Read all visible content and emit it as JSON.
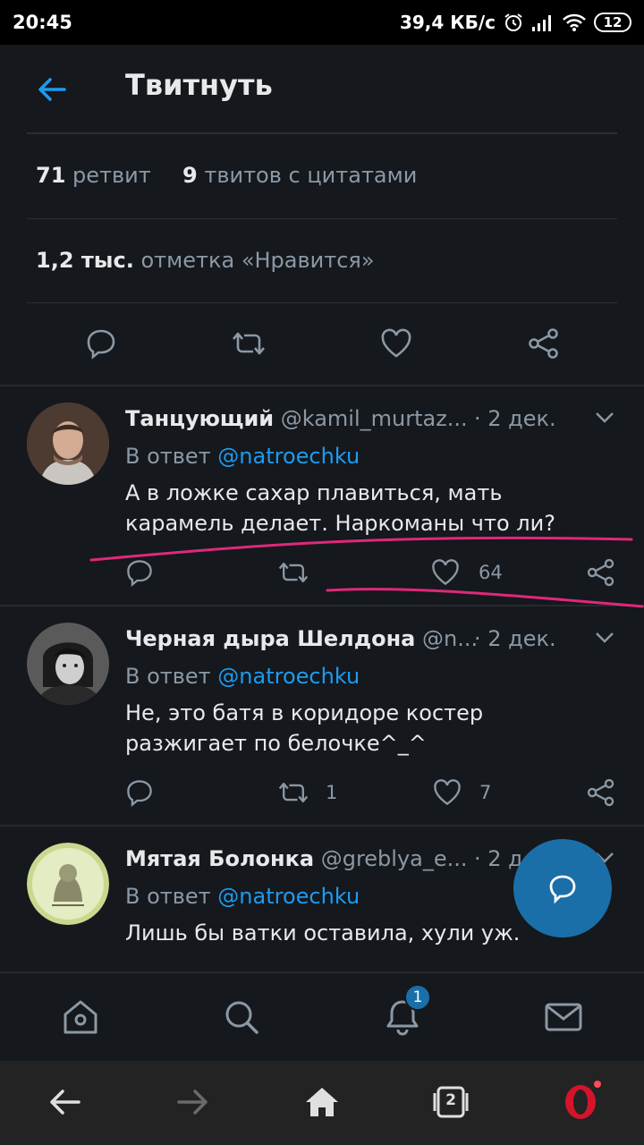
{
  "status_bar": {
    "time": "20:45",
    "network_speed": "39,4 КБ/с",
    "battery": "12"
  },
  "header": {
    "title": "Твитнуть",
    "back_icon": "arrow-left-icon"
  },
  "stats": {
    "retweets_count": "71",
    "retweets_label": "ретвит",
    "quotes_count": "9",
    "quotes_label": "твитов с цитатами",
    "likes_count": "1,2 тыс.",
    "likes_label": "отметка «Нравится»"
  },
  "replies": [
    {
      "name": "Танцующий",
      "handle": "@kamil_murtaz...",
      "date": "· 2 дек.",
      "reply_prefix": "В ответ",
      "reply_to": "@natroechku",
      "text": "А в ложке сахар плавиться, мать карамель делает. Наркоманы что ли?",
      "retweets": "",
      "likes": "64"
    },
    {
      "name": "Черная дыра Шелдона",
      "handle": "@n...",
      "date": "· 2 дек.",
      "reply_prefix": "В ответ",
      "reply_to": "@natroechku",
      "text": "Не, это батя в коридоре костер разжигает по белочке^_^",
      "retweets": "1",
      "likes": "7"
    },
    {
      "name": "Мятая Болонка",
      "handle": "@greblya_e...",
      "date": "· 2 д",
      "reply_prefix": "В ответ",
      "reply_to": "@natroechku",
      "text": "Лишь бы ватки оставила, хули уж."
    }
  ],
  "bottom_nav": {
    "notification_badge": "1"
  },
  "browser_bar": {
    "tabs_count": "2"
  },
  "colors": {
    "background": "#15181c",
    "accent": "#1d9bf0",
    "fab": "#1a6fa8",
    "secondary_text": "#8b98a5",
    "annotation_stroke": "#e0287a"
  }
}
